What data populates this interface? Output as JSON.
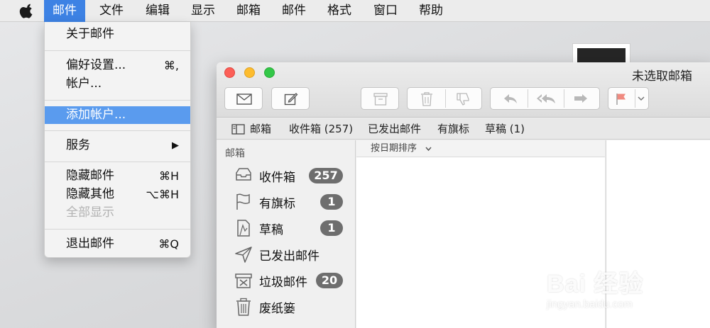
{
  "menubar": {
    "apple_icon": "apple-logo-icon",
    "items": [
      "邮件",
      "文件",
      "编辑",
      "显示",
      "邮箱",
      "邮件",
      "格式",
      "窗口",
      "帮助"
    ],
    "active_index": 0,
    "active_color": "#3d82e4"
  },
  "dropdown": {
    "items": [
      {
        "label": "关于邮件",
        "shortcut": ""
      },
      {
        "label": "偏好设置...",
        "shortcut": "⌘,"
      },
      {
        "label": "帐户...",
        "shortcut": ""
      },
      {
        "label": "添加帐户...",
        "shortcut": "",
        "highlighted": true
      },
      {
        "label": "服务",
        "shortcut": "▶"
      },
      {
        "label": "隐藏邮件",
        "shortcut": "⌘H"
      },
      {
        "label": "隐藏其他",
        "shortcut": "⌥⌘H"
      },
      {
        "label": "全部显示",
        "shortcut": "",
        "disabled": true
      },
      {
        "label": "退出邮件",
        "shortcut": "⌘Q"
      }
    ],
    "highlight_color": "#5a9bee"
  },
  "window": {
    "title": "未选取邮箱",
    "traffic_lights": {
      "close": "#fc5f57",
      "minimize": "#fdbc2e",
      "zoom": "#33c748"
    },
    "toolbar": {
      "get_mail_icon": "envelope-icon",
      "compose_icon": "compose-icon",
      "archive_icon": "archive-icon",
      "delete_icon": "trash-icon",
      "junk_icon": "thumbs-down-icon",
      "reply_icon": "reply-icon",
      "reply_all_icon": "reply-all-icon",
      "forward_icon": "forward-icon",
      "flag_icon": "flag-icon",
      "flag_color": "#f08a80"
    },
    "favorites": {
      "sidebar_toggle_icon": "sidebar-icon",
      "items": [
        "邮箱",
        "收件箱 (257)",
        "已发出邮件",
        "有旗标",
        "草稿 (1)"
      ]
    },
    "sidebar": {
      "heading": "邮箱",
      "items": [
        {
          "label": "收件箱",
          "icon": "inbox-icon",
          "badge": "257"
        },
        {
          "label": "有旗标",
          "icon": "flag-icon",
          "badge": "1"
        },
        {
          "label": "草稿",
          "icon": "draft-icon",
          "badge": "1"
        },
        {
          "label": "已发出邮件",
          "icon": "sent-icon",
          "badge": ""
        },
        {
          "label": "垃圾邮件",
          "icon": "junk-icon",
          "badge": "20"
        },
        {
          "label": "废纸篓",
          "icon": "trash-icon",
          "badge": ""
        }
      ]
    },
    "list": {
      "sort_label": "按日期排序"
    }
  },
  "watermark": {
    "line1": "Bai 经验",
    "line2": "jingyan.baidu.com"
  }
}
